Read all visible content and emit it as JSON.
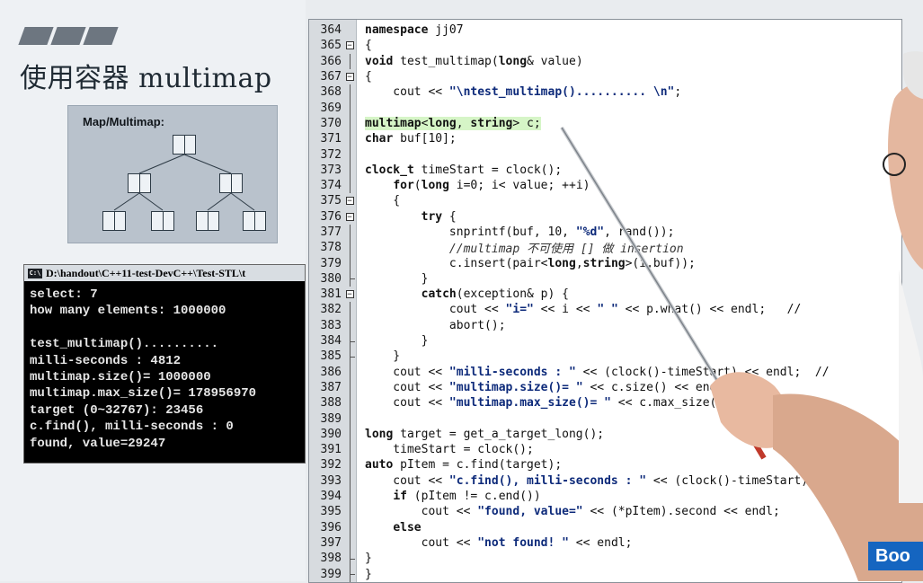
{
  "slide": {
    "title": "使用容器 multimap",
    "diagram_title": "Map/Multimap:"
  },
  "console": {
    "title": "D:\\handout\\C++11-test-DevC++\\Test-STL\\t",
    "icon": "C:\\",
    "lines": [
      "select: 7",
      "how many elements: 1000000",
      "",
      "test_multimap()..........",
      "milli-seconds : 4812",
      "multimap.size()= 1000000",
      "multimap.max_size()= 178956970",
      "target (0~32767): 23456",
      "c.find(), milli-seconds : 0",
      "found, value=29247"
    ]
  },
  "code": [
    {
      "n": "364",
      "t": "namespace jj07",
      "fold": ""
    },
    {
      "n": "365",
      "t": "{",
      "fold": "box"
    },
    {
      "n": "366",
      "t": "void test_multimap(long& value)",
      "fold": "line"
    },
    {
      "n": "367",
      "t": "{",
      "fold": "box"
    },
    {
      "n": "368",
      "t": "    cout << \"\\ntest_multimap().......... \\n\";",
      "fold": "line"
    },
    {
      "n": "369",
      "t": "",
      "fold": "line"
    },
    {
      "n": "370",
      "t": "multimap<long, string> c;",
      "fold": "line",
      "hl": true
    },
    {
      "n": "371",
      "t": "char buf[10];",
      "fold": "line"
    },
    {
      "n": "372",
      "t": "",
      "fold": "line"
    },
    {
      "n": "373",
      "t": "clock_t timeStart = clock();",
      "fold": "line"
    },
    {
      "n": "374",
      "t": "    for(long i=0; i< value; ++i)",
      "fold": "line"
    },
    {
      "n": "375",
      "t": "    {",
      "fold": "box"
    },
    {
      "n": "376",
      "t": "        try {",
      "fold": "box"
    },
    {
      "n": "377",
      "t": "            snprintf(buf, 10, \"%d\", rand());",
      "fold": "line"
    },
    {
      "n": "378",
      "t": "            //multimap 不可使用 [] 做 insertion",
      "fold": "line"
    },
    {
      "n": "379",
      "t": "            c.insert(pair<long,string>(i,buf));",
      "fold": "line"
    },
    {
      "n": "380",
      "t": "        }",
      "fold": "end"
    },
    {
      "n": "381",
      "t": "        catch(exception& p) {",
      "fold": "box"
    },
    {
      "n": "382",
      "t": "            cout << \"i=\" << i << \" \" << p.what() << endl;   //",
      "fold": "line"
    },
    {
      "n": "383",
      "t": "            abort();",
      "fold": "line"
    },
    {
      "n": "384",
      "t": "        }",
      "fold": "end"
    },
    {
      "n": "385",
      "t": "    }",
      "fold": "end"
    },
    {
      "n": "386",
      "t": "    cout << \"milli-seconds : \" << (clock()-timeStart) << endl;  //",
      "fold": "line"
    },
    {
      "n": "387",
      "t": "    cout << \"multimap.size()= \" << c.size() << endl;",
      "fold": "line"
    },
    {
      "n": "388",
      "t": "    cout << \"multimap.max_size()= \" << c.max_size() << endl;",
      "fold": "line"
    },
    {
      "n": "389",
      "t": "",
      "fold": "line"
    },
    {
      "n": "390",
      "t": "long target = get_a_target_long();",
      "fold": "line"
    },
    {
      "n": "391",
      "t": "    timeStart = clock();",
      "fold": "line"
    },
    {
      "n": "392",
      "t": "auto pItem = c.find(target);",
      "fold": "line"
    },
    {
      "n": "393",
      "t": "    cout << \"c.find(), milli-seconds : \" << (clock()-timeStart) << endl;",
      "fold": "line"
    },
    {
      "n": "394",
      "t": "    if (pItem != c.end())",
      "fold": "line"
    },
    {
      "n": "395",
      "t": "        cout << \"found, value=\" << (*pItem).second << endl;",
      "fold": "line"
    },
    {
      "n": "396",
      "t": "    else",
      "fold": "line"
    },
    {
      "n": "397",
      "t": "        cout << \"not found! \" << endl;",
      "fold": "line"
    },
    {
      "n": "398",
      "t": "}",
      "fold": "end"
    },
    {
      "n": "399",
      "t": "}",
      "fold": "end"
    }
  ],
  "logo": {
    "text": "Boo"
  },
  "colors": {
    "highlight": "#d6f5c7",
    "gutter": "#d7dbdf",
    "console_bg": "#000000"
  }
}
